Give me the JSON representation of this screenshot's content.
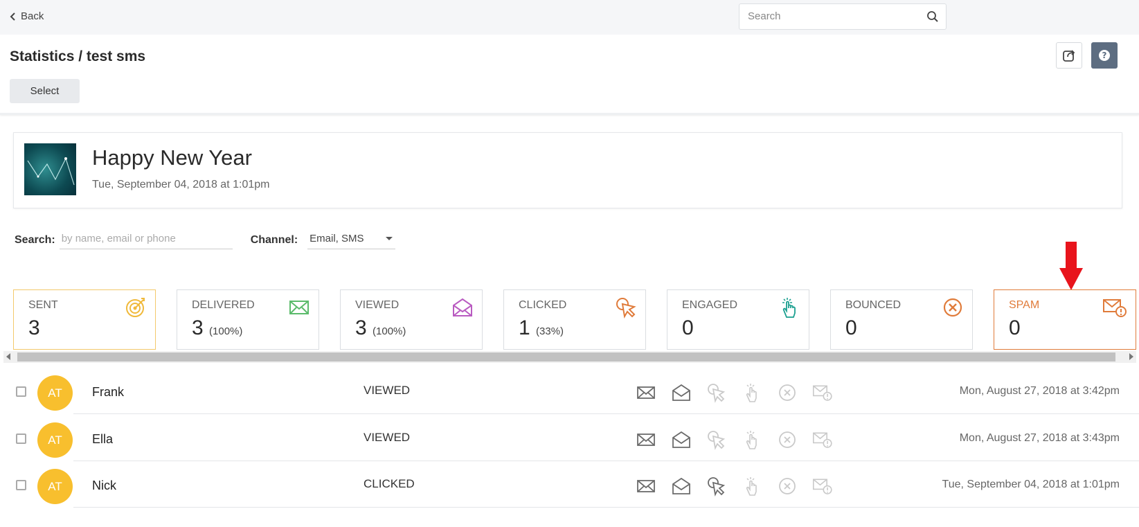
{
  "topbar": {
    "back_label": "Back",
    "search_placeholder": "Search"
  },
  "header": {
    "title": "Statistics / test sms",
    "select_label": "Select"
  },
  "campaign": {
    "name": "Happy New Year",
    "date": "Tue, September 04, 2018 at 1:01pm"
  },
  "filters": {
    "search_label": "Search:",
    "search_placeholder": "by name, email or phone",
    "channel_label": "Channel:",
    "channel_value": "Email, SMS"
  },
  "stats": [
    {
      "label": "SENT",
      "value": "3",
      "pct": "",
      "icon": "target-icon",
      "color": "#f0b93a"
    },
    {
      "label": "DELIVERED",
      "value": "3",
      "pct": "(100%)",
      "icon": "envelope-icon",
      "color": "#5bbb6b"
    },
    {
      "label": "VIEWED",
      "value": "3",
      "pct": "(100%)",
      "icon": "envelope-open-icon",
      "color": "#b95bc1"
    },
    {
      "label": "CLICKED",
      "value": "1",
      "pct": "(33%)",
      "icon": "cursor-click-icon",
      "color": "#e07b3a"
    },
    {
      "label": "ENGAGED",
      "value": "0",
      "pct": "",
      "icon": "hand-tap-icon",
      "color": "#1a9f8f"
    },
    {
      "label": "BOUNCED",
      "value": "0",
      "pct": "",
      "icon": "x-circle-icon",
      "color": "#e07b3a"
    },
    {
      "label": "SPAM",
      "value": "0",
      "pct": "",
      "icon": "envelope-alert-icon",
      "color": "#e07b3a"
    }
  ],
  "rows": [
    {
      "initials": "AT",
      "name": "Frank",
      "status": "VIEWED",
      "timestamp": "Mon, August 27, 2018 at 3:42pm",
      "clicked": false
    },
    {
      "initials": "AT",
      "name": "Ella",
      "status": "VIEWED",
      "timestamp": "Mon, August 27, 2018 at 3:43pm",
      "clicked": false
    },
    {
      "initials": "AT",
      "name": "Nick",
      "status": "CLICKED",
      "timestamp": "Tue, September 04, 2018 at 1:01pm",
      "clicked": true
    }
  ],
  "colors": {
    "accent_avatar": "#f8bf2e",
    "help_button": "#5d6d81",
    "annotation_arrow": "#e8141c"
  }
}
